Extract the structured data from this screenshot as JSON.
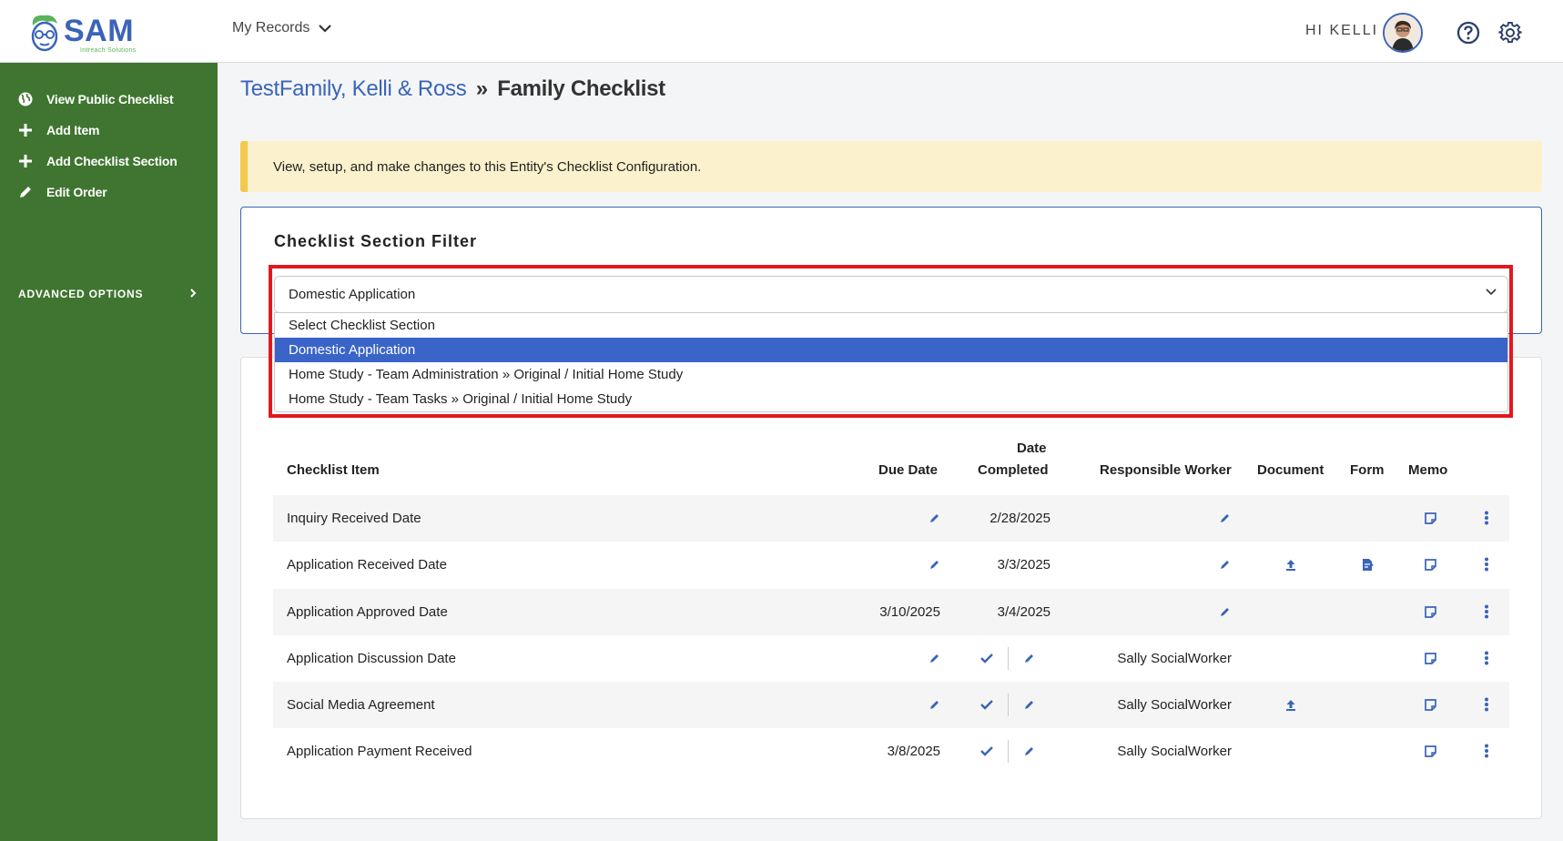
{
  "header": {
    "logo_text": "SAM",
    "logo_subtext": "Intreach Solutions",
    "records_menu_label": "My Records",
    "greeting": "HI KELLI"
  },
  "sidebar": {
    "items": [
      {
        "label": "View Public Checklist",
        "icon": "globe-icon"
      },
      {
        "label": "Add Item",
        "icon": "plus-icon"
      },
      {
        "label": "Add Checklist Section",
        "icon": "plus-icon"
      },
      {
        "label": "Edit Order",
        "icon": "pencil-icon"
      }
    ],
    "advanced_label": "ADVANCED OPTIONS"
  },
  "breadcrumb": {
    "family_link": "TestFamily, Kelli & Ross",
    "separator": "»",
    "current": "Family Checklist"
  },
  "notice": {
    "text": "View, setup, and make changes to this Entity's Checklist Configuration."
  },
  "filter": {
    "title": "Checklist Section Filter",
    "selected": "Domestic Application",
    "options": [
      "Select Checklist Section",
      "Domestic Application",
      "Home Study - Team Administration » Original / Initial Home Study",
      "Home Study - Team Tasks » Original / Initial Home Study"
    ]
  },
  "table": {
    "headers": {
      "item": "Checklist Item",
      "due_date": "Due Date",
      "date_completed_line1": "Date",
      "date_completed_line2": "Completed",
      "worker": "Responsible Worker",
      "document": "Document",
      "form": "Form",
      "memo": "Memo"
    },
    "rows": [
      {
        "item": "Inquiry Received Date",
        "due_date": "",
        "date_completed": "2/28/2025",
        "worker": ""
      },
      {
        "item": "Application Received Date",
        "due_date": "",
        "date_completed": "3/3/2025",
        "worker": ""
      },
      {
        "item": "Application Approved Date",
        "due_date": "3/10/2025",
        "date_completed": "3/4/2025",
        "worker": ""
      },
      {
        "item": "Application Discussion Date",
        "due_date": "",
        "date_completed": "",
        "worker": "Sally SocialWorker"
      },
      {
        "item": "Social Media Agreement",
        "due_date": "",
        "date_completed": "",
        "worker": "Sally SocialWorker"
      },
      {
        "item": "Application Payment Received",
        "due_date": "3/8/2025",
        "date_completed": "",
        "worker": "Sally SocialWorker"
      }
    ]
  },
  "colors": {
    "sidebar_bg": "#3f7530",
    "accent_blue": "#3a64b8",
    "highlight_red": "#e0191e",
    "notice_bg": "#fbf1cc",
    "notice_border": "#f2c94c"
  }
}
